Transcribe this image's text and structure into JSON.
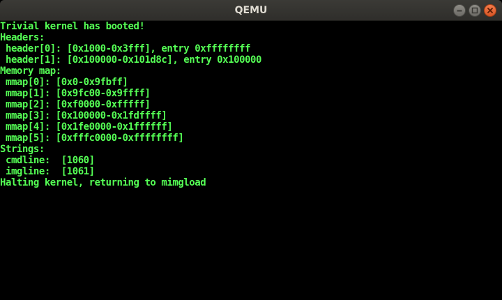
{
  "window": {
    "title": "QEMU"
  },
  "colors": {
    "terminal_text": "#55ff55",
    "terminal_background": "#000000",
    "titlebar": "#3b3a36",
    "close_button": "#e95b27"
  },
  "console": {
    "lines": [
      "Trivial kernel has booted!",
      "Headers:",
      " header[0]: [0x1000-0x3fff], entry 0xffffffff",
      " header[1]: [0x100000-0x101d8c], entry 0x100000",
      "Memory map:",
      " mmap[0]: [0x0-0x9fbff]",
      " mmap[1]: [0x9fc00-0x9ffff]",
      " mmap[2]: [0xf0000-0xfffff]",
      " mmap[3]: [0x100000-0x1fdffff]",
      " mmap[4]: [0x1fe0000-0x1ffffff]",
      " mmap[5]: [0xfffc0000-0xffffffff]",
      "Strings:",
      " cmdline:  [1060]",
      " imgline:  [1061]",
      "Halting kernel, returning to mimgload"
    ]
  }
}
